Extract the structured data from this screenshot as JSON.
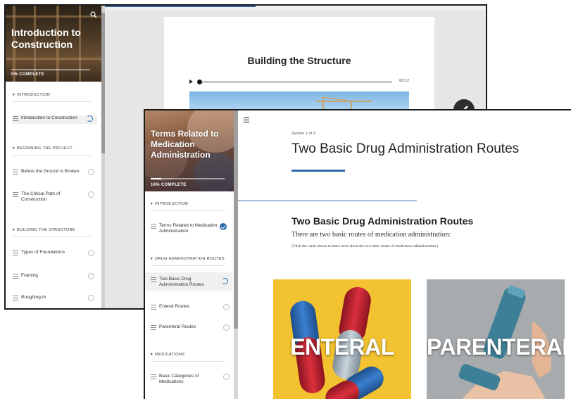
{
  "back_window": {
    "course_title": "Introduction to Construction",
    "progress_text": "0% COMPLETE",
    "lesson_heading": "Building the Structure",
    "audio_time": "00:12",
    "sections": [
      {
        "title": "INTRODUCTION",
        "lessons": [
          "Introduction to Construction"
        ]
      },
      {
        "title": "BEGINNING THE PROJECT",
        "lessons": [
          "Before the Ground is Broken",
          "The Critical Path of Construction"
        ]
      },
      {
        "title": "BUILDING THE STRUCTURE",
        "lessons": [
          "Types of Foundations",
          "Framing",
          "Roughing-In"
        ]
      }
    ]
  },
  "front_window": {
    "course_title": "Terms Related to Medication Administration",
    "progress_text": "14% COMPLETE",
    "progress_fraction": 0.14,
    "section_label": "Section 1 of 3",
    "lesson_title": "Two Basic Drug Administration Routes",
    "content_heading": "Two Basic Drug Administration Routes",
    "content_intro": "There are two basic routes of medication administration:",
    "content_instruction": "(Click the cards shown to learn more about the two basic routes of medication administration.)",
    "cards": [
      {
        "label": "ENTERAL"
      },
      {
        "label": "PARENTERAL"
      }
    ],
    "sections": [
      {
        "title": "INTRODUCTION",
        "lessons": [
          "Terms Related to Medication Administration"
        ]
      },
      {
        "title": "DRUG ADMINISTRATION ROUTES",
        "lessons": [
          "Two Basic Drug Administration Routes",
          "Enteral Routes",
          "Parenteral Routes"
        ]
      },
      {
        "title": "MEDICATIONS",
        "lessons": [
          "Basic Categories of Medications"
        ]
      }
    ]
  },
  "icons": [
    "search-icon",
    "menu-icon",
    "play-icon",
    "next-arrow-icon",
    "lesson-lines-icon",
    "checkmark-icon",
    "progress-spinner-icon",
    "status-circle-icon"
  ],
  "colors": {
    "accent": "#2d6aa8",
    "enteral_card": "#f2c230",
    "parenteral_card": "#9fa3a6"
  }
}
